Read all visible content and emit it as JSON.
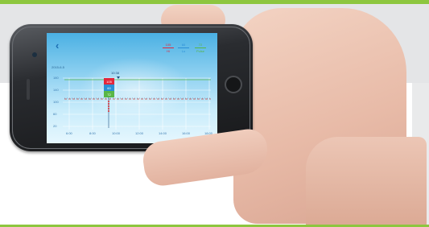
{
  "scene": {
    "accent_color": "#8dc63f",
    "background_color": "#ffffff",
    "panel_color": "#e4e5e7"
  },
  "app": {
    "back_icon": "back-chevron-icon",
    "date_text": "2015-6-5",
    "marker_time": "10:38",
    "legend": [
      {
        "value": "105",
        "label": "Hi",
        "color": "#e3263b"
      },
      {
        "value": "60",
        "label": "Lo",
        "color": "#2a8fd6"
      },
      {
        "value": "72",
        "label": "Pulse",
        "color": "#59b646"
      }
    ],
    "chart": {
      "y_ticks": [
        "180",
        "140",
        "100",
        "60",
        "20"
      ],
      "x_ticks": [
        "6:00",
        "8:00",
        "10:00",
        "12:00",
        "14:00",
        "16:00",
        "18:00"
      ],
      "reading_values": [
        "105",
        "60",
        "72"
      ]
    }
  }
}
